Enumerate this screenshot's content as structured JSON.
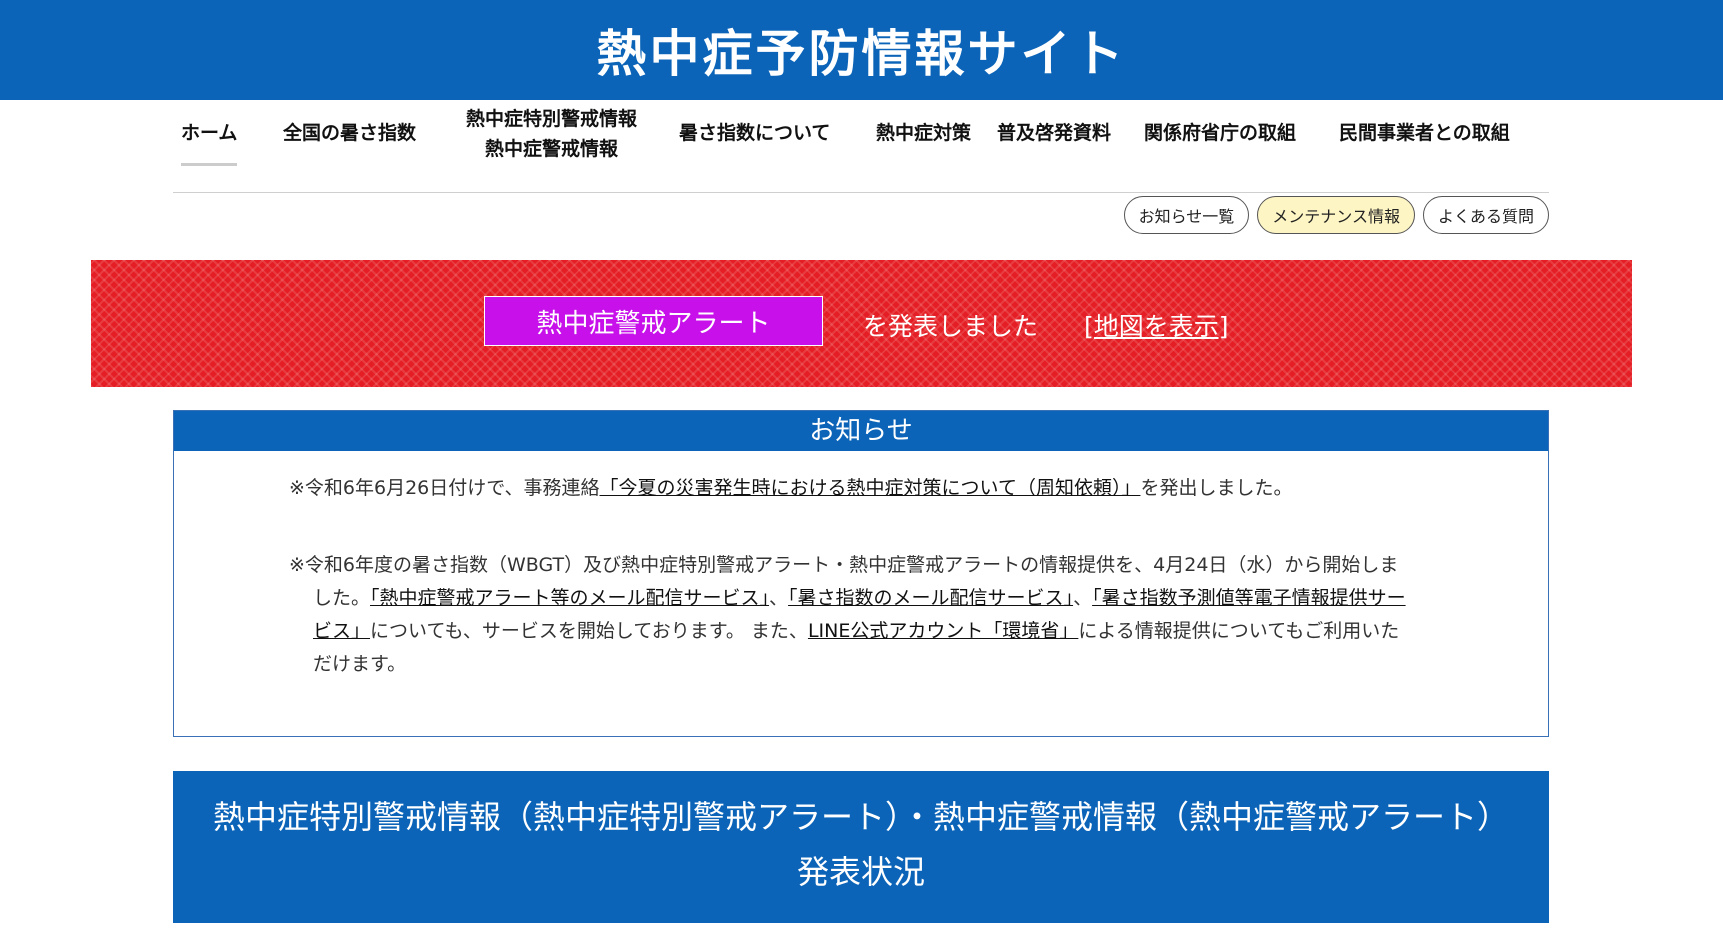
{
  "header": {
    "title": "熱中症予防情報サイト"
  },
  "nav": {
    "items": [
      {
        "label": "ホーム"
      },
      {
        "label": "全国の暑さ指数"
      },
      {
        "label": "熱中症特別警戒情報",
        "label2": "熱中症警戒情報"
      },
      {
        "label": "暑さ指数について"
      },
      {
        "label": "熱中症対策"
      },
      {
        "label": "普及啓発資料"
      },
      {
        "label": "関係府省庁の取組"
      },
      {
        "label": "民間事業者との取組"
      }
    ]
  },
  "pills": {
    "news_list": "お知らせ一覧",
    "maintenance": "メンテナンス情報",
    "faq": "よくある質問"
  },
  "alert": {
    "badge": "熱中症警戒アラート",
    "text": "を発表しました",
    "map_link": "[地図を表示]"
  },
  "notice": {
    "heading": "お知らせ",
    "p1_pre": "※令和6年6月26日付けで、事務連絡",
    "p1_link": "「今夏の災害発生時における熱中症対策について（周知依頼）」",
    "p1_post": "を発出しました。",
    "p2_pre": "※令和6年度の暑さ指数（WBGT）及び熱中症特別警戒アラート・熱中症警戒アラートの情報提供を、4月24日（水）から開始しました。",
    "p2_link1": "「熱中症警戒アラート等のメール配信サービス」",
    "p2_sep1": "、",
    "p2_link2": "「暑さ指数のメール配信サービス」",
    "p2_sep2": "、",
    "p2_link3": "「暑さ指数予測値等電子情報提供サービス」",
    "p2_mid": "についても、サービスを開始しております。 また、",
    "p2_link4": "LINE公式アカウント「環境省」",
    "p2_post": "による情報提供についてもご利用いただけます。"
  },
  "status": {
    "title": "熱中症特別警戒情報（熱中症特別警戒アラート）・熱中症警戒情報（熱中症警戒アラート）",
    "subtitle": "発表状況"
  },
  "colors": {
    "brand_blue": "#0b64b8",
    "alert_red": "#e41e24",
    "alert_badge_purple": "#c710ea",
    "maintenance_pill": "#fdf5c4"
  }
}
